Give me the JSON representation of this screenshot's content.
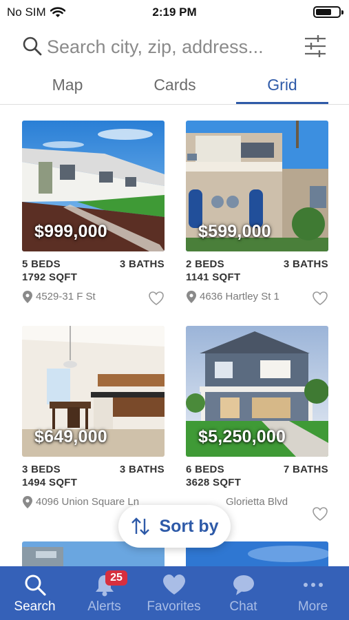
{
  "status_bar": {
    "carrier": "No SIM",
    "time": "2:19 PM"
  },
  "search": {
    "placeholder": "Search city, zip, address..."
  },
  "view_tabs": [
    {
      "label": "Map",
      "active": false
    },
    {
      "label": "Cards",
      "active": false
    },
    {
      "label": "Grid",
      "active": true
    }
  ],
  "listings": [
    {
      "price": "$999,000",
      "beds": "5 BEDS",
      "baths": "3 BATHS",
      "sqft": "1792 SQFT",
      "address": "4529-31 F St"
    },
    {
      "price": "$599,000",
      "beds": "2 BEDS",
      "baths": "3 BATHS",
      "sqft": "1141 SQFT",
      "address": "4636 Hartley St 1"
    },
    {
      "price": "$649,000",
      "beds": "3 BEDS",
      "baths": "3 BATHS",
      "sqft": "1494 SQFT",
      "address": "4096 Union Square Ln"
    },
    {
      "price": "$5,250,000",
      "beds": "6 BEDS",
      "baths": "7 BATHS",
      "sqft": "3628 SQFT",
      "address": "Glorietta Blvd"
    }
  ],
  "sort_button": {
    "label": "Sort by"
  },
  "tab_bar": [
    {
      "label": "Search",
      "icon": "search-icon",
      "active": true
    },
    {
      "label": "Alerts",
      "icon": "bell-icon",
      "badge": "25",
      "active": false
    },
    {
      "label": "Favorites",
      "icon": "heart-icon",
      "active": false
    },
    {
      "label": "Chat",
      "icon": "chat-bubble-icon",
      "active": false
    },
    {
      "label": "More",
      "icon": "more-dots-icon",
      "active": false
    }
  ],
  "colors": {
    "accent": "#2e5aa8",
    "tab_bar_bg": "#3561b8",
    "badge": "#d62f3f"
  }
}
